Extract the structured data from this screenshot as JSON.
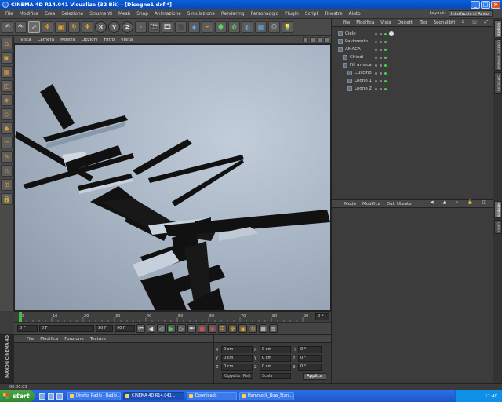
{
  "window": {
    "title": "CINEMA 4D R14.041 Visualize (32 Bit) - [Disegno1.dxf *]"
  },
  "menu": [
    "File",
    "Modifica",
    "Crea",
    "Selezione",
    "Strumenti",
    "Mesh",
    "Snap",
    "Animazione",
    "Simulazione",
    "Rendering",
    "Personaggio",
    "Plugin",
    "Script",
    "Finestre",
    "Aiuto"
  ],
  "layout": {
    "label": "Layout:",
    "value": "Interfaccia di Avvio"
  },
  "viewport": {
    "menu": [
      "Vista",
      "Camera",
      "Mostra",
      "Opzioni",
      "Filtro",
      "Visita"
    ]
  },
  "timeline": {
    "ticks": [
      "0",
      "10",
      "20",
      "30",
      "40",
      "50",
      "60",
      "70",
      "80",
      "90"
    ],
    "current_frame": "0 F"
  },
  "playback": {
    "start": "0 F",
    "current": "0 F",
    "end": "90 F",
    "max": "90 F"
  },
  "materials": {
    "menu": [
      "File",
      "Modifica",
      "Funzione",
      "Texture"
    ]
  },
  "coords": {
    "header": "---",
    "rows": [
      {
        "a": "X",
        "av": "0 cm",
        "b": "X",
        "bv": "0 cm",
        "c": "H",
        "cv": "0 °"
      },
      {
        "a": "Y",
        "av": "0 cm",
        "b": "Y",
        "bv": "0 cm",
        "c": "P",
        "cv": "0 °"
      },
      {
        "a": "Z",
        "av": "0 cm",
        "b": "Z",
        "bv": "0 cm",
        "c": "B",
        "cv": "0 °"
      }
    ],
    "mode": "Oggetto (Rel)",
    "scale": "Scala",
    "apply": "Applica"
  },
  "objects": {
    "menu": [
      "File",
      "Modifica",
      "Vista",
      "Oggetti",
      "Tag",
      "Segnalibri"
    ],
    "items": [
      {
        "label": "Cielo",
        "depth": 0
      },
      {
        "label": "Pavimento",
        "depth": 0
      },
      {
        "label": "AMACA",
        "depth": 0
      },
      {
        "label": "Chiodi",
        "depth": 1
      },
      {
        "label": "Fili amaca",
        "depth": 1
      },
      {
        "label": "Cuscino",
        "depth": 2
      },
      {
        "label": "Legno 1",
        "depth": 2
      },
      {
        "label": "Legno 2",
        "depth": 2
      }
    ]
  },
  "attributes": {
    "menu": [
      "Modo",
      "Modifica",
      "Dati Utente"
    ]
  },
  "right_tabs": [
    "Oggetti",
    "Content Browser",
    "Struttura",
    "Attributi",
    "Livelli"
  ],
  "statusbar": {
    "time": "00:00:03"
  },
  "maxon": "MAXON CINEMA 4D",
  "taskbar": {
    "start": "start",
    "tasks": [
      "Diretta Radio - Radio ...",
      "CINEMA 4D R14.041 ...",
      "Downloads",
      "Hammock_Bow_Stan..."
    ],
    "clock": "11:40"
  },
  "colors": {
    "accent_orange": "#f6a51a",
    "titlebar": "#0a5fd8",
    "panel": "#3c3c3c",
    "viewport_bg": "#a9b6c5"
  }
}
